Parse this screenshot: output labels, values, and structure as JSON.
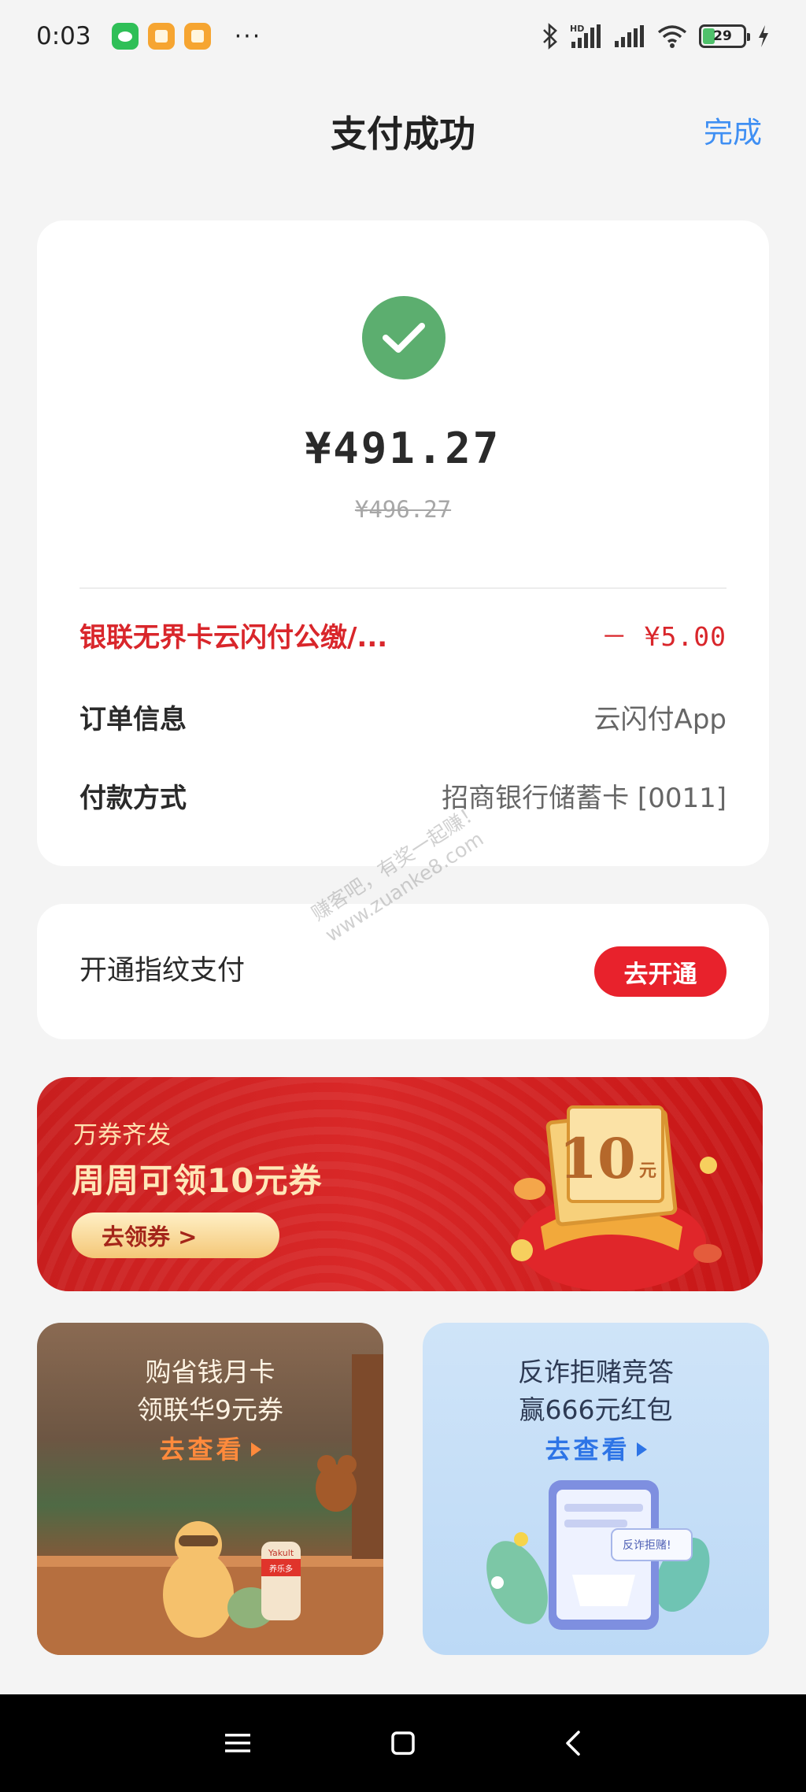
{
  "status_bar": {
    "time": "0:03",
    "battery": "29",
    "apps": [
      "wechat-icon",
      "note-icon",
      "note-icon"
    ],
    "more": "···"
  },
  "header": {
    "title": "支付成功",
    "done_label": "完成"
  },
  "payment": {
    "amount": "¥491.27",
    "original_amount": "¥496.27",
    "discount": {
      "label": "银联无界卡云闪付公缴/...",
      "value": "－ ¥5.00"
    },
    "order_info": {
      "label": "订单信息",
      "value": "云闪付App"
    },
    "pay_method": {
      "label": "付款方式",
      "value": "招商银行储蓄卡 [0011]"
    }
  },
  "fingerprint": {
    "label": "开通指纹支付",
    "button": "去开通"
  },
  "banner": {
    "subtitle": "万券齐发",
    "title": "周周可领10元券",
    "button": "去领券 >",
    "coupon_amount": "10",
    "coupon_unit": "元"
  },
  "promos": [
    {
      "line1": "购省钱月卡",
      "line2": "领联华9元券",
      "link": "去查看",
      "product_label": "Yakult",
      "brand_label": "养乐多"
    },
    {
      "line1": "反诈拒赌竞答",
      "line2": "赢666元红包",
      "link": "去查看",
      "phone_tag": "反诈拒赌!"
    }
  ],
  "watermark": {
    "line1": "赚客吧，有奖一起赚！",
    "line2": "www.zuanke8.com"
  },
  "colors": {
    "accent_blue": "#3f8ff3",
    "success_green": "#5cae6f",
    "discount_red": "#d9262b",
    "button_red": "#e8222c"
  }
}
